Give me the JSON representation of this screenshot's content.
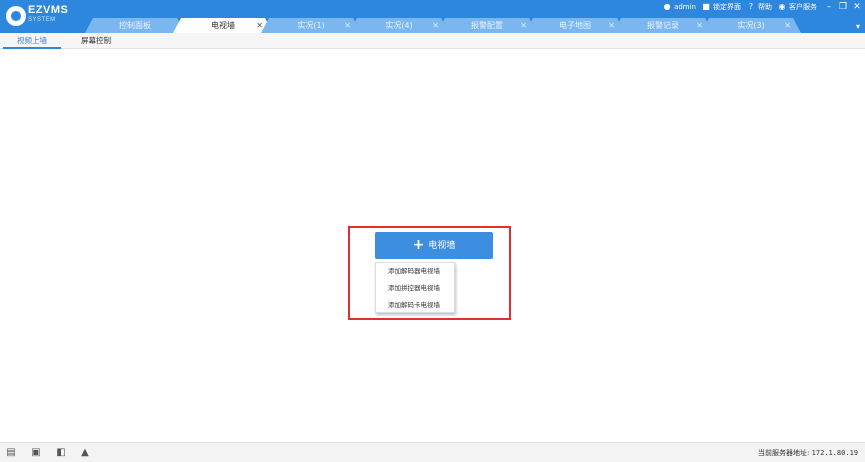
{
  "app": {
    "logo_text": "EZVMS",
    "logo_sub": "SYSTEM"
  },
  "toolbar": {
    "user": "admin",
    "lock": "锁定界面",
    "help": "帮助",
    "service": "客户服务"
  },
  "tabs": [
    {
      "label": "控制面板",
      "closable": false,
      "active": false
    },
    {
      "label": "电视墙",
      "closable": true,
      "active": true
    },
    {
      "label": "实况(1)",
      "closable": true,
      "active": false
    },
    {
      "label": "实况(4)",
      "closable": true,
      "active": false
    },
    {
      "label": "报警配置",
      "closable": true,
      "active": false
    },
    {
      "label": "电子地图",
      "closable": true,
      "active": false
    },
    {
      "label": "报警记录",
      "closable": true,
      "active": false
    },
    {
      "label": "实况(3)",
      "closable": true,
      "active": false
    }
  ],
  "subtabs": [
    {
      "label": "视频上墙",
      "active": true
    },
    {
      "label": "屏幕控制",
      "active": false
    }
  ],
  "main": {
    "add_button": "电视墙",
    "menu": [
      "添加解码器电视墙",
      "添加拼控器电视墙",
      "添加解码卡电视墙"
    ]
  },
  "status": {
    "server_label": "当前服务器地址:",
    "server_ip": "172.1.80.19"
  },
  "colors": {
    "accent": "#2d87df",
    "tab_inactive": "#7cb6ee",
    "highlight_border": "#e03030",
    "button": "#3d8ee0"
  }
}
